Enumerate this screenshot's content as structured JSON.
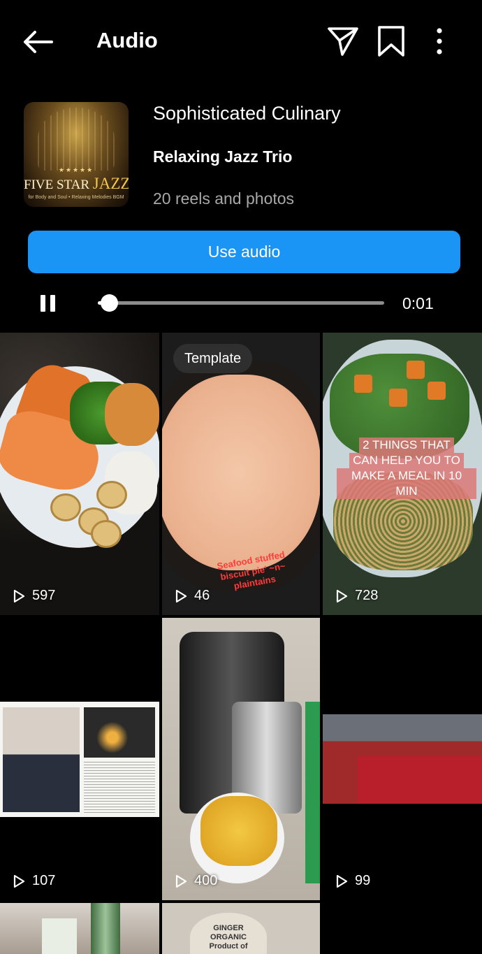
{
  "header": {
    "title": "Audio",
    "back_icon": "arrow-left-icon",
    "share_icon": "paper-plane-icon",
    "save_icon": "bookmark-icon",
    "more_icon": "more-vertical-icon"
  },
  "audio": {
    "cover_stars": "★★★★★",
    "cover_brand_a": "FIVE STAR ",
    "cover_brand_b": "JAZZ",
    "cover_tagline": "for Body and Soul • Relaxing Melodies BGM",
    "title": "Sophisticated Culinary",
    "artist": "Relaxing Jazz Trio",
    "count": "20 reels and photos",
    "use_label": "Use audio",
    "elapsed": "0:01",
    "progress": 0.04,
    "accent": "#1a95f5"
  },
  "grid": {
    "tiles": [
      {
        "views": "597"
      },
      {
        "views": "46",
        "badge": "Template",
        "caption": "Seafood stuffed biscuit pie' ~n~ plaintains"
      },
      {
        "views": "728",
        "overlay": [
          "2 THINGS THAT",
          "CAN HELP YOU TO",
          "MAKE A MEAL IN 10 MIN"
        ]
      },
      {
        "views": "107"
      },
      {
        "views": "400"
      },
      {
        "views": "99"
      },
      {},
      {
        "jar_label": "GINGER ORGANIC Product of"
      },
      {}
    ]
  }
}
